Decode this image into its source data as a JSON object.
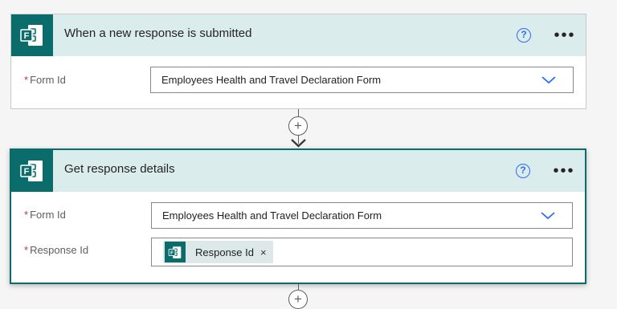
{
  "trigger_card": {
    "title": "When a new response is submitted",
    "help_glyph": "?",
    "more_glyph": "•••",
    "form_id": {
      "required_mark": "*",
      "label": "Form Id",
      "value": "Employees Health and Travel Declaration Form"
    },
    "icon": "microsoft-forms-icon"
  },
  "connector": {
    "add_glyph": "+"
  },
  "action_card": {
    "title": "Get response details",
    "help_glyph": "?",
    "more_glyph": "•••",
    "form_id": {
      "required_mark": "*",
      "label": "Form Id",
      "value": "Employees Health and Travel Declaration Form"
    },
    "response_id": {
      "required_mark": "*",
      "label": "Response Id",
      "token_label": "Response Id",
      "token_remove": "×"
    },
    "icon": "microsoft-forms-icon"
  },
  "colors": {
    "forms_teal": "#0a6d6b",
    "header_bg": "#daeceb",
    "help_blue": "#2f6cf6",
    "required_red": "#c4314b"
  }
}
